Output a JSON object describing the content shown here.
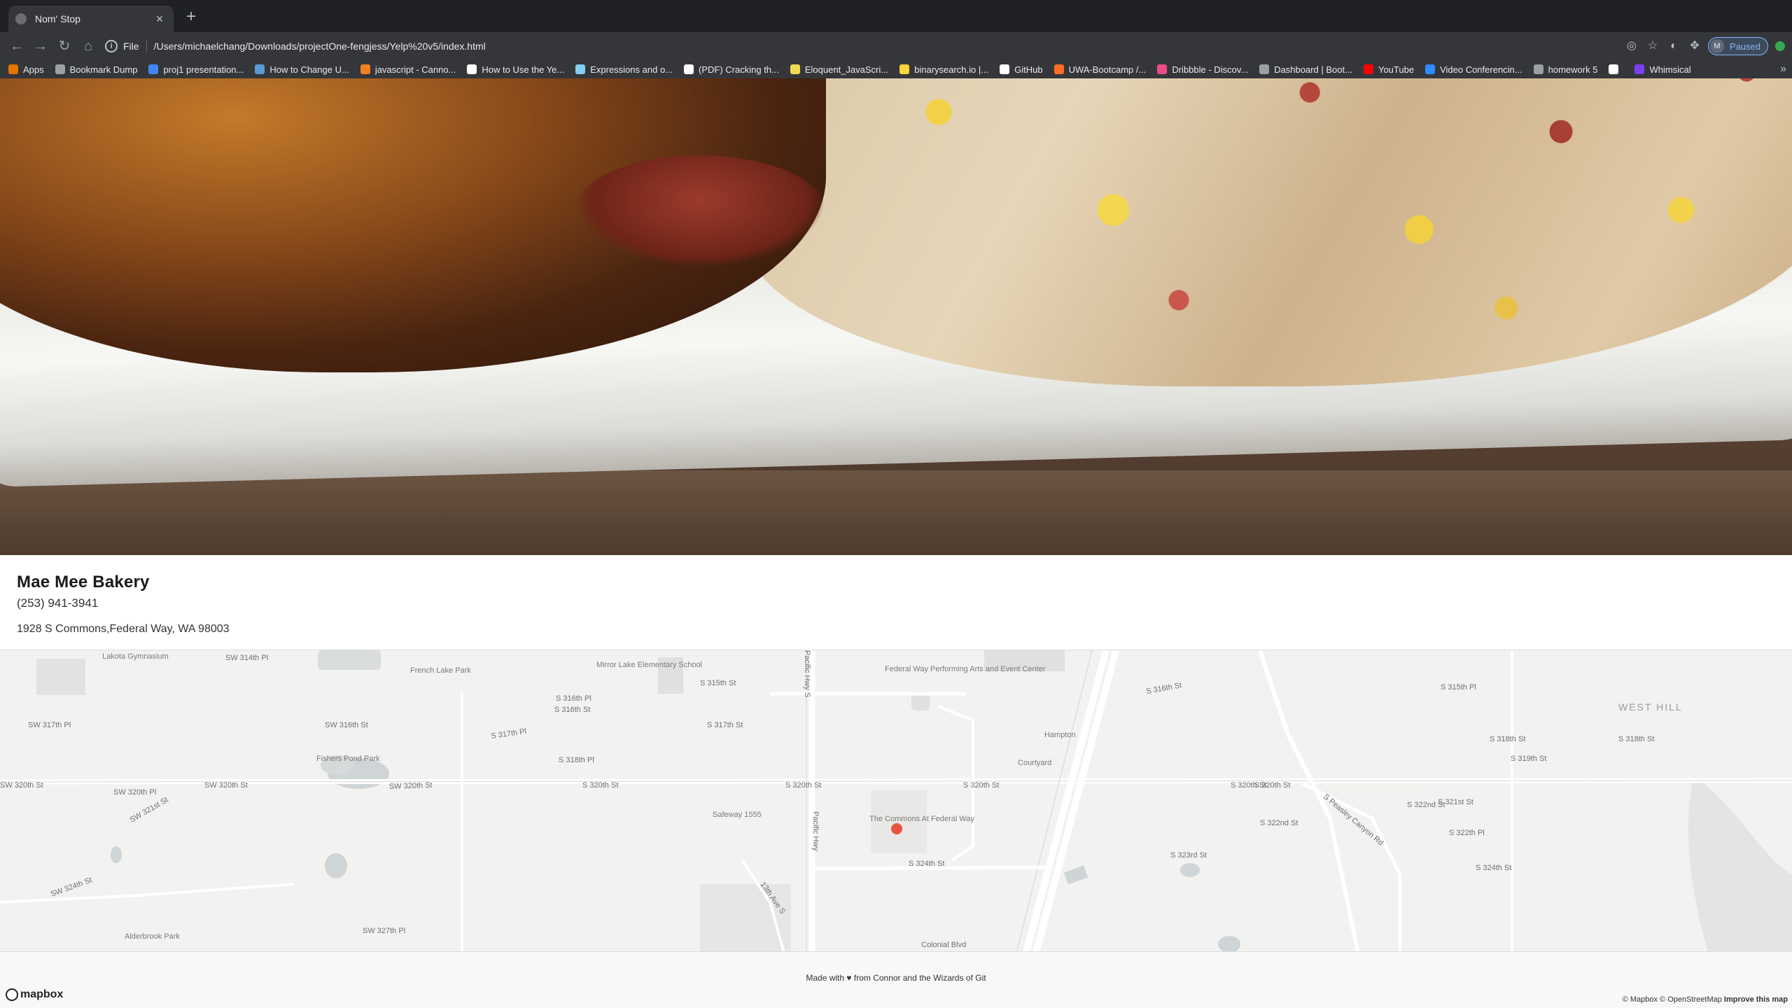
{
  "browser": {
    "tab_title": "Nom' Stop",
    "tab_close": "×",
    "new_tab": "+",
    "nav": {
      "back": "←",
      "forward": "→",
      "reload": "↻",
      "home": "⌂"
    },
    "omnibox": {
      "info": "i",
      "scheme": "File",
      "url": "/Users/michaelchang/Downloads/projectOne-fengjess/Yelp%20v5/index.html"
    },
    "toolbar_icons": {
      "location": "◎",
      "star": "☆",
      "ext1": "◐",
      "puzzle": "✥"
    },
    "profile": {
      "initial": "M",
      "label": "Paused"
    },
    "bookmarks": [
      {
        "label": "Apps",
        "icon": "apps-grid-icon",
        "color": "#e37400"
      },
      {
        "label": "Bookmark Dump",
        "icon": "folder-icon",
        "color": "#9aa0a6"
      },
      {
        "label": "proj1 presentation...",
        "icon": "slides-icon",
        "color": "#4285f4"
      },
      {
        "label": "How to Change U...",
        "icon": "page-icon",
        "color": "#5b9bd5"
      },
      {
        "label": "javascript - Canno...",
        "icon": "stackoverflow-icon",
        "color": "#f48024"
      },
      {
        "label": "How to Use the Ye...",
        "icon": "medium-icon",
        "color": "#ffffff"
      },
      {
        "label": "Expressions and o...",
        "icon": "mdn-icon",
        "color": "#83d0f2"
      },
      {
        "label": "(PDF) Cracking th...",
        "icon": "academia-icon",
        "color": "#ffffff"
      },
      {
        "label": "Eloquent_JavaScri...",
        "icon": "js-icon",
        "color": "#f0db4f"
      },
      {
        "label": "binarysearch.io |...",
        "icon": "binarysearch-icon",
        "color": "#ffd43b"
      },
      {
        "label": "GitHub",
        "icon": "github-icon",
        "color": "#ffffff"
      },
      {
        "label": "UWA-Bootcamp /...",
        "icon": "gitlab-icon",
        "color": "#fc6d26"
      },
      {
        "label": "Dribbble - Discov...",
        "icon": "dribbble-icon",
        "color": "#ea4c89"
      },
      {
        "label": "Dashboard | Boot...",
        "icon": "globe-icon",
        "color": "#9aa0a6"
      },
      {
        "label": "YouTube",
        "icon": "youtube-icon",
        "color": "#ff0000"
      },
      {
        "label": "Video Conferencin...",
        "icon": "zoom-icon",
        "color": "#2d8cff"
      },
      {
        "label": "homework 5",
        "icon": "folder-icon",
        "color": "#9aa0a6"
      },
      {
        "label": "",
        "icon": "x-icon",
        "color": "#ffffff"
      },
      {
        "label": "Whimsical",
        "icon": "whimsical-icon",
        "color": "#7b3ff2"
      }
    ],
    "bookmarks_more": "»"
  },
  "business": {
    "name": "Mae Mee Bakery",
    "phone": "(253) 941-3941",
    "address": "1928 S Commons,Federal Way, WA 98003"
  },
  "map": {
    "area_label": "WEST HILL",
    "marker_color": "#e8553e",
    "streets": [
      "SW 320th St",
      "SW 320th St",
      "SW 320th St",
      "S 320th St",
      "S 320th St",
      "S 320th St",
      "S 320th St",
      "S 320th St",
      "SW 316th St",
      "S 316th St",
      "S 316th Pl",
      "S 315th St",
      "S 317th St",
      "S 317th Pl",
      "S 318th Pl",
      "S 322nd St",
      "S 322nd St",
      "S 323rd St",
      "S 324th St",
      "S 324th St",
      "SW 324th St",
      "SW 327th Pl",
      "S Peasley Canyon Rd",
      "Pacific Hwy S",
      "Pacific Hwy",
      "13th Ave S",
      "SW 314th Pl",
      "SW 317th Pl",
      "SW 320th Pl",
      "SW 321st St",
      "S 315th Pl",
      "S 318th St",
      "S 319th St",
      "S 321st St",
      "S 322th Pl",
      "S 316th St",
      "S 318th St",
      "Colonial Blvd"
    ],
    "pois": [
      "Lakota Gymnasium",
      "French Lake Park",
      "Mirror Lake Elementary School",
      "Federal Way Performing Arts and Event Center",
      "Hampton",
      "Courtyard",
      "Fishers Pond Park",
      "Safeway 1555",
      "The Commons At Federal Way",
      "Alderbrook Park"
    ]
  },
  "footer": {
    "credit": "Made with ♥ from Connor and the Wizards of Git",
    "mapbox_logo": "mapbox",
    "attribution": "© Mapbox © OpenStreetMap",
    "improve": "Improve this map"
  }
}
